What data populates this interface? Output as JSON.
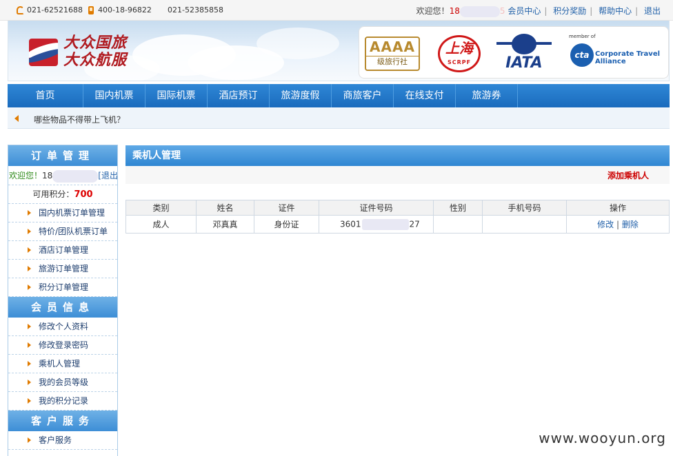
{
  "topbar": {
    "phone1": "021-62521688",
    "phone2": "400-18-96822",
    "phone3": "021-52385858",
    "welcome": "欢迎您！",
    "user_prefix": "18",
    "user_suffix": "5",
    "links": [
      "会员中心",
      "积分奖励",
      "帮助中心",
      "退出"
    ]
  },
  "banner": {
    "logo_line1": "大众国旅",
    "logo_line2": "大众航服",
    "aaaa_title": "AAAA",
    "aaaa_sub": "级旅行社",
    "scrpf_num": "上海",
    "scrpf_text": "SCRPF",
    "iata_text": "IATA",
    "cta_member": "member of",
    "cta_mark": "cta",
    "cta_line1": "Corporate Travel",
    "cta_line2": "Alliance"
  },
  "nav": [
    "首页",
    "国内机票",
    "国际机票",
    "酒店预订",
    "旅游度假",
    "商旅客户",
    "在线支付",
    "旅游券"
  ],
  "notice": {
    "text": "哪些物品不得带上飞机？"
  },
  "sidebar": {
    "order_head": "订单管理",
    "welcome": "欢迎您！",
    "user_prefix": "18",
    "logout": "[退出]",
    "points_label": "可用积分：",
    "points_value": "700",
    "order_items": [
      "国内机票订单管理",
      "特价/团队机票订单",
      "酒店订单管理",
      "旅游订单管理",
      "积分订单管理"
    ],
    "member_head": "会员信息",
    "member_items": [
      "修改个人资料",
      "修改登录密码",
      "乘机人管理",
      "我的会员等级",
      "我的积分记录"
    ],
    "service_head": "客户服务",
    "service_items": [
      "客户服务"
    ]
  },
  "main": {
    "title": "乘机人管理",
    "add_label": "添加乘机人",
    "columns": [
      "类别",
      "姓名",
      "证件",
      "证件号码",
      "性别",
      "手机号码",
      "操作"
    ],
    "rows": [
      {
        "type": "成人",
        "name": "邓真真",
        "doc": "身份证",
        "id_prefix": "3601",
        "id_suffix": "27",
        "gender": "",
        "mobile": "",
        "edit": "修改",
        "delete": "删除"
      }
    ]
  },
  "watermark": "www.wooyun.org",
  "colors": {
    "nav_blue": "#1a6bbd",
    "accent_red": "#cc0000",
    "orange": "#e07b00"
  }
}
